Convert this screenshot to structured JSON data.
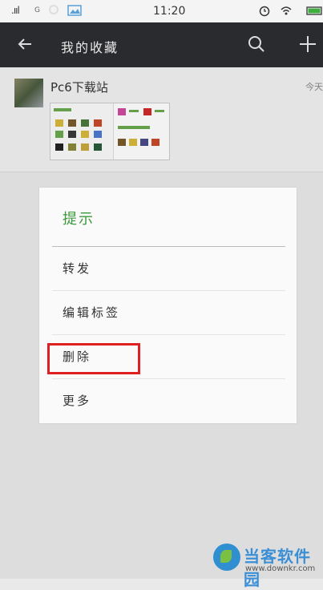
{
  "status_bar": {
    "signal": ".ııl",
    "network": "G",
    "time": "11:20"
  },
  "app_bar": {
    "title": "我的收藏"
  },
  "favorites": [
    {
      "source": "Pc6下载站",
      "date": "今天"
    }
  ],
  "dialog": {
    "title": "提示",
    "items": [
      "转发",
      "编辑标签",
      "删除",
      "更多"
    ]
  },
  "watermark": {
    "title": "当客软件园",
    "url": "www.downkr.com"
  },
  "colors": {
    "dialog_title": "#3a9a3a",
    "highlight": "#e02020",
    "appbar_bg": "#2a2b2e"
  }
}
